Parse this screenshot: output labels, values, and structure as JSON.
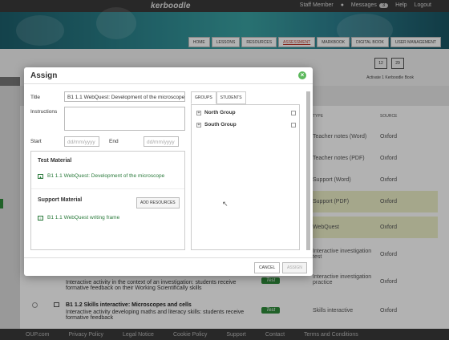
{
  "app": {
    "brand": "kerboodle",
    "top_links": [
      "Staff Member",
      "Messages",
      "Help",
      "Logout"
    ],
    "messages_count": "3"
  },
  "nav_tabs": [
    {
      "label": "HOME",
      "active": false
    },
    {
      "label": "LESSONS",
      "active": false
    },
    {
      "label": "RESOURCES",
      "active": false
    },
    {
      "label": "ASSESSMENT",
      "active": true
    },
    {
      "label": "MARKBOOK",
      "active": false
    },
    {
      "label": "DIGITAL BOOK",
      "active": false
    },
    {
      "label": "USER MANAGEMENT",
      "active": false
    }
  ],
  "ebook": {
    "label": "Activate 1 Kerboodle Book",
    "values": [
      "12",
      "29"
    ]
  },
  "table": {
    "headers": {
      "type": "TYPE",
      "source": "SOURCE"
    },
    "rows": [
      {
        "type": "Teacher notes (Word)",
        "source": "Oxford",
        "highlight": false
      },
      {
        "type": "Teacher notes (PDF)",
        "source": "Oxford",
        "highlight": false
      },
      {
        "type": "Support (Word)",
        "source": "Oxford",
        "highlight": false
      },
      {
        "type": "Support (PDF)",
        "source": "Oxford",
        "highlight": true
      },
      {
        "type": "WebQuest",
        "source": "Oxford",
        "highlight": true
      },
      {
        "type": "Interactive investigation test",
        "source": "Oxford",
        "highlight": false
      },
      {
        "type": "Interactive investigation practice",
        "source": "Oxford",
        "highlight": false
      },
      {
        "type": "Skills interactive",
        "source": "Oxford",
        "highlight": false
      }
    ],
    "lower_items": [
      {
        "text": "Interactive activity in the context of an investigation: students receive formative feedback on their Working Scientifically skills",
        "badge": "Test"
      },
      {
        "title": "B1 1.2 Skills interactive: Microscopes and cells",
        "text": "Interactive activity developing maths and literacy skills: students receive formative feedback",
        "badge": "Test"
      }
    ]
  },
  "footer": {
    "links": [
      "OUP.com",
      "Privacy Policy",
      "Legal Notice",
      "Cookie Policy",
      "Support",
      "Contact",
      "Terms and Conditions"
    ]
  },
  "modal": {
    "title": "Assign",
    "title_label": "Title",
    "title_value": "B1 1.1 WebQuest: Development of the microscope",
    "instructions_label": "Instructions",
    "start_label": "Start",
    "start_placeholder": "dd/mm/yyyy",
    "end_label": "End",
    "end_placeholder": "dd/mm/yyyy",
    "test_material_heading": "Test Material",
    "test_material_item": "B1 1.1 WebQuest: Development of the microscope",
    "support_material_heading": "Support Material",
    "add_resources_label": "ADD RESOURCES",
    "support_material_item": "B1 1.1 WebQuest writing frame",
    "tabs": [
      "GROUPS",
      "STUDENTS"
    ],
    "groups": [
      "North Group",
      "South Group"
    ],
    "cancel_label": "CANCEL",
    "assign_label": "ASSIGN"
  },
  "colors": {
    "accent_green": "#2e8b3a",
    "header_dark": "#3a3a3a",
    "highlight_row": "#ecefc8"
  }
}
